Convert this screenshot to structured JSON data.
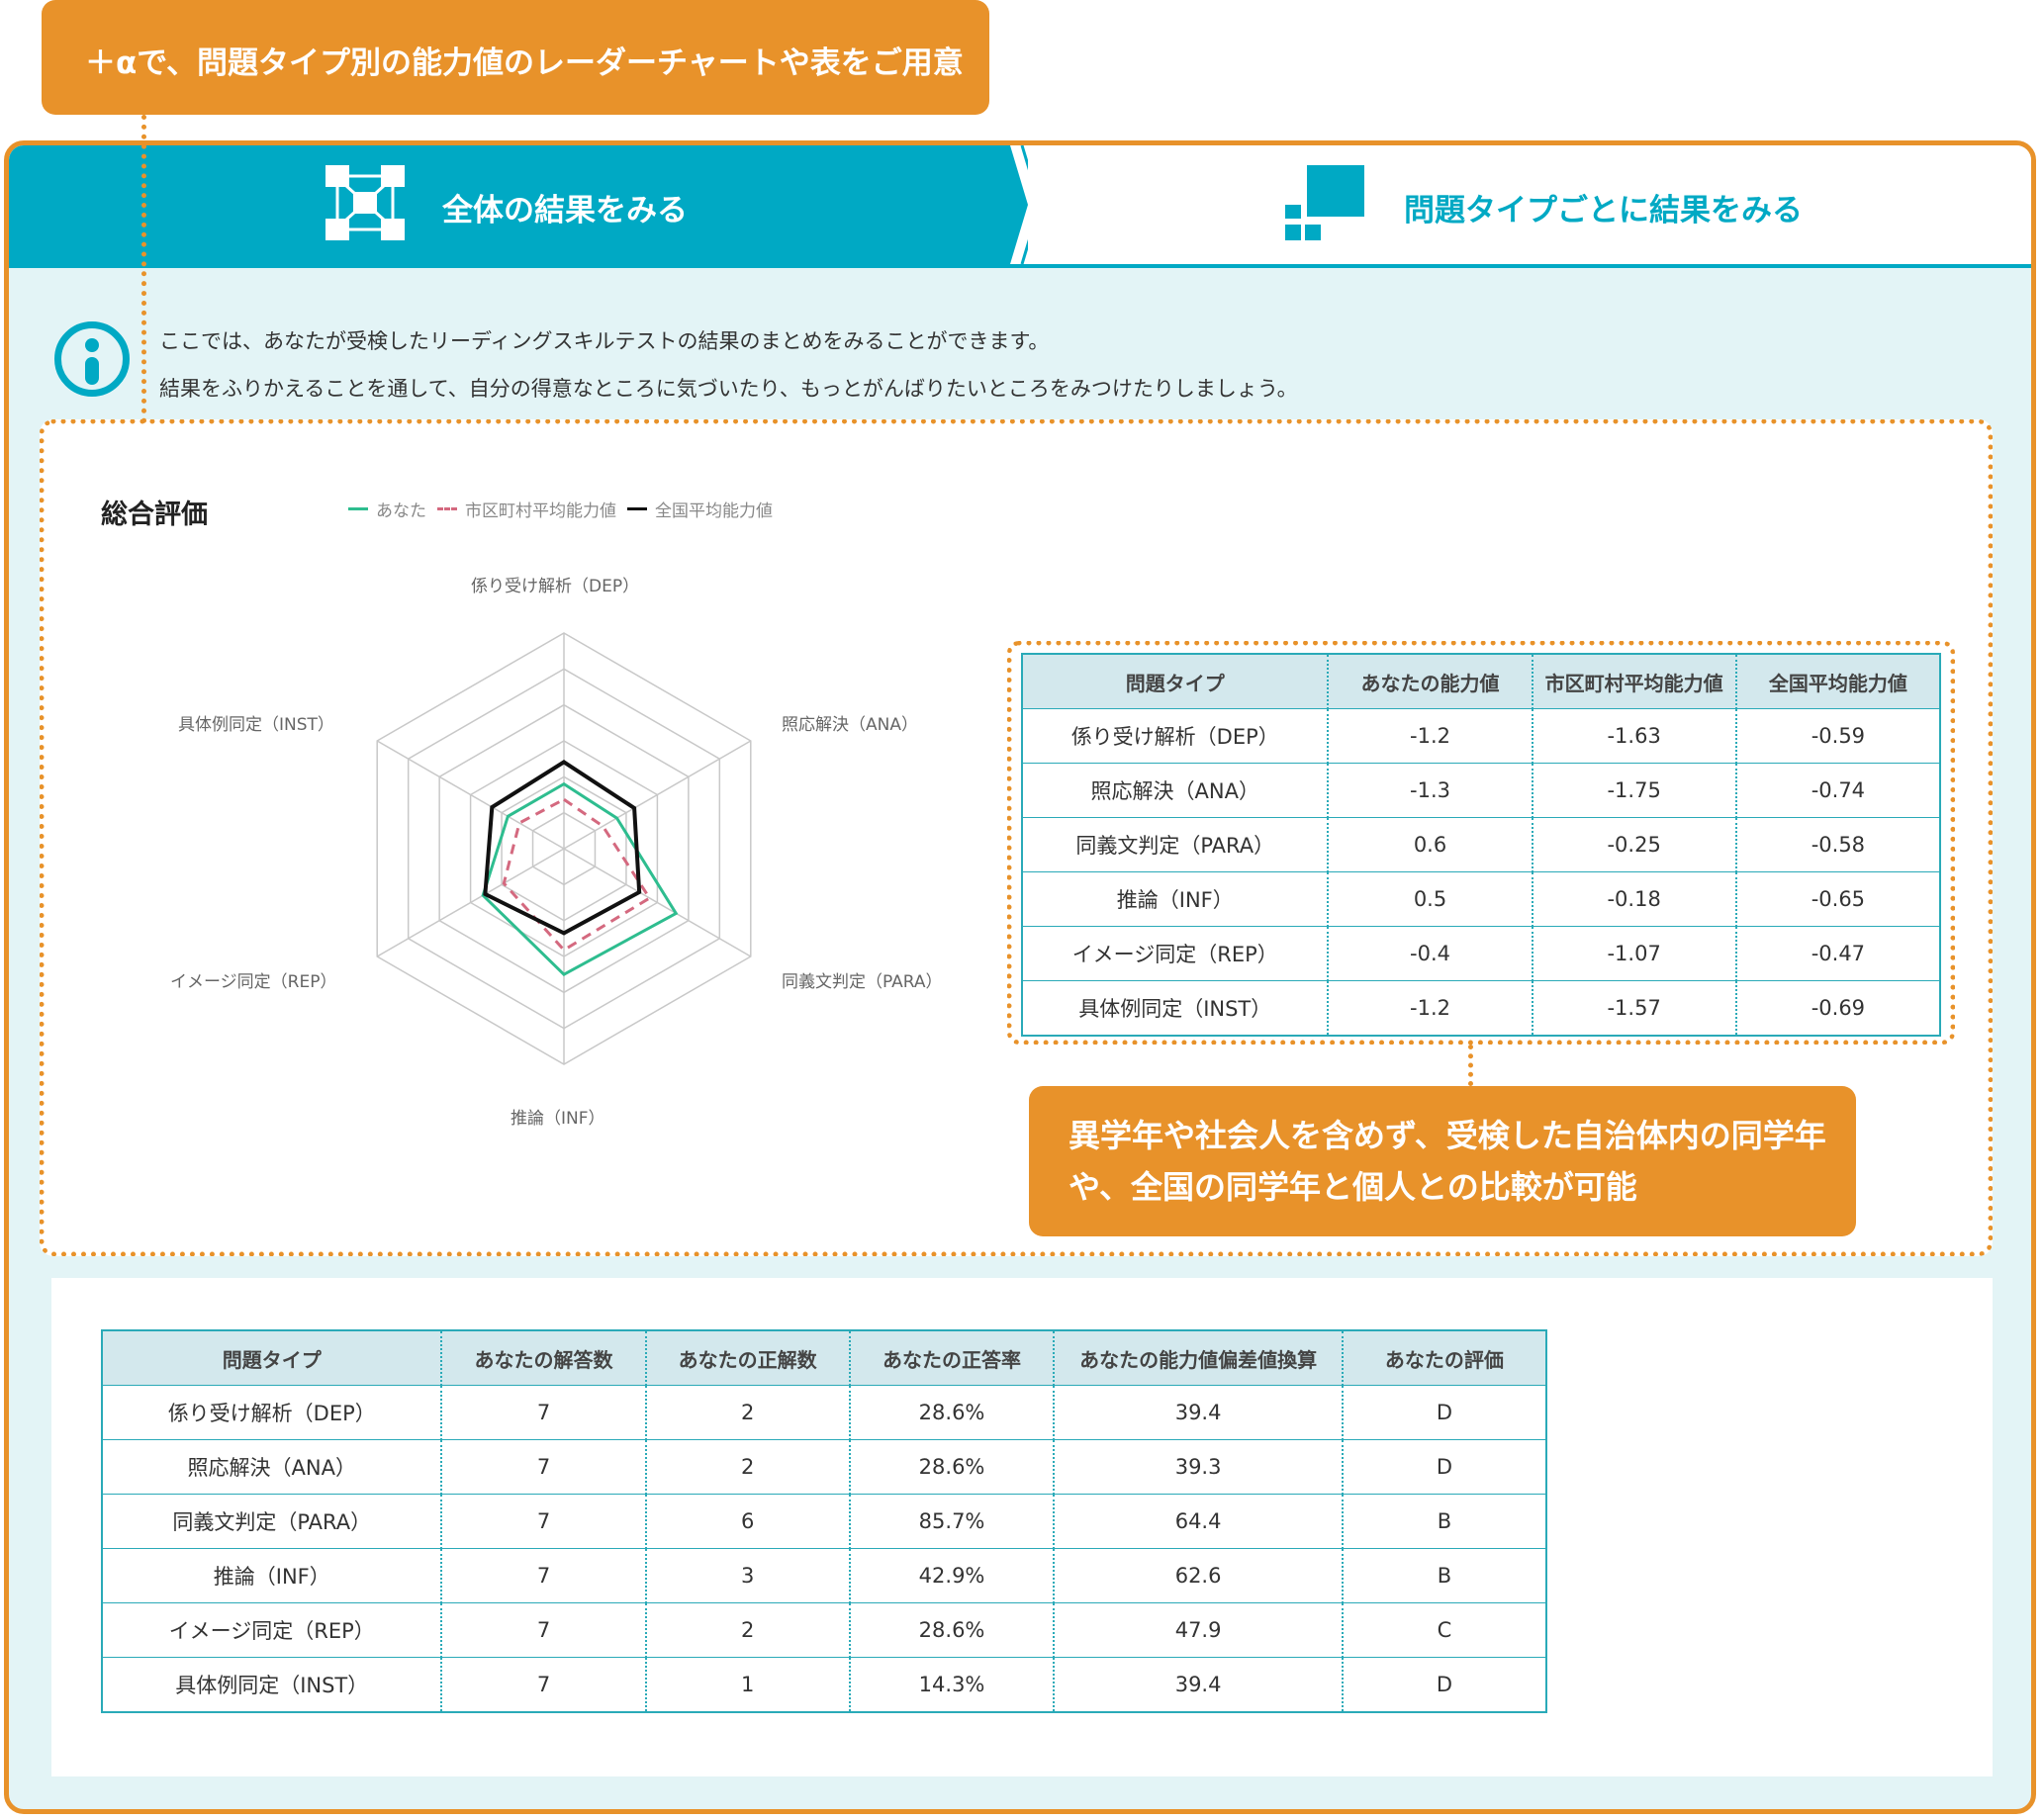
{
  "callouts": {
    "top": "＋αで、問題タイプ別の能力値のレーダーチャートや表をご用意",
    "bottom_line1": "異学年や社会人を含めず、受検した自治体内の同学年",
    "bottom_line2": "や、全国の同学年と個人との比較が可能"
  },
  "tabs": {
    "overall": "全体の結果をみる",
    "by_type": "問題タイプごとに結果をみる"
  },
  "intro": {
    "line1": "ここでは、あなたが受検したリーディングスキルテストの結果のまとめをみることができます。",
    "line2": "結果をふりかえることを通して、自分の得意なところに気づいたり、もっとがんばりたいところをみつけたりしましょう。"
  },
  "summary": {
    "title": "総合評価"
  },
  "colors": {
    "orange": "#e8922a",
    "teal": "#00a9c4",
    "you": "#2ebd8f",
    "municipal": "#d4697f",
    "national": "#111111"
  },
  "chart_data": {
    "type": "radar",
    "axes": [
      "係り受け解析（DEP）",
      "照応解決（ANA）",
      "同義文判定（PARA）",
      "推論（INF）",
      "イメージ同定（REP）",
      "具体例同定（INST）"
    ],
    "series": [
      {
        "name": "あなた",
        "values": [
          -1.2,
          -1.3,
          0.6,
          0.5,
          -0.4,
          -1.2
        ]
      },
      {
        "name": "市区町村平均能力値",
        "values": [
          -1.63,
          -1.75,
          -0.25,
          -0.18,
          -1.07,
          -1.57
        ]
      },
      {
        "name": "全国平均能力値",
        "values": [
          -0.59,
          -0.74,
          -0.58,
          -0.65,
          -0.47,
          -0.69
        ]
      }
    ],
    "range": [
      -3,
      3
    ],
    "rings": 6
  },
  "ability_table": {
    "headers": [
      "問題タイプ",
      "あなたの能力値",
      "市区町村平均能力値",
      "全国平均能力値"
    ],
    "rows": [
      [
        "係り受け解析（DEP）",
        "-1.2",
        "-1.63",
        "-0.59"
      ],
      [
        "照応解決（ANA）",
        "-1.3",
        "-1.75",
        "-0.74"
      ],
      [
        "同義文判定（PARA）",
        "0.6",
        "-0.25",
        "-0.58"
      ],
      [
        "推論（INF）",
        "0.5",
        "-0.18",
        "-0.65"
      ],
      [
        "イメージ同定（REP）",
        "-0.4",
        "-1.07",
        "-0.47"
      ],
      [
        "具体例同定（INST）",
        "-1.2",
        "-1.57",
        "-0.69"
      ]
    ]
  },
  "result_table": {
    "headers": [
      "問題タイプ",
      "あなたの解答数",
      "あなたの正解数",
      "あなたの正答率",
      "あなたの能力値偏差値換算",
      "あなたの評価"
    ],
    "rows": [
      [
        "係り受け解析（DEP）",
        "7",
        "2",
        "28.6%",
        "39.4",
        "D"
      ],
      [
        "照応解決（ANA）",
        "7",
        "2",
        "28.6%",
        "39.3",
        "D"
      ],
      [
        "同義文判定（PARA）",
        "7",
        "6",
        "85.7%",
        "64.4",
        "B"
      ],
      [
        "推論（INF）",
        "7",
        "3",
        "42.9%",
        "62.6",
        "B"
      ],
      [
        "イメージ同定（REP）",
        "7",
        "2",
        "28.6%",
        "47.9",
        "C"
      ],
      [
        "具体例同定（INST）",
        "7",
        "1",
        "14.3%",
        "39.4",
        "D"
      ]
    ]
  }
}
